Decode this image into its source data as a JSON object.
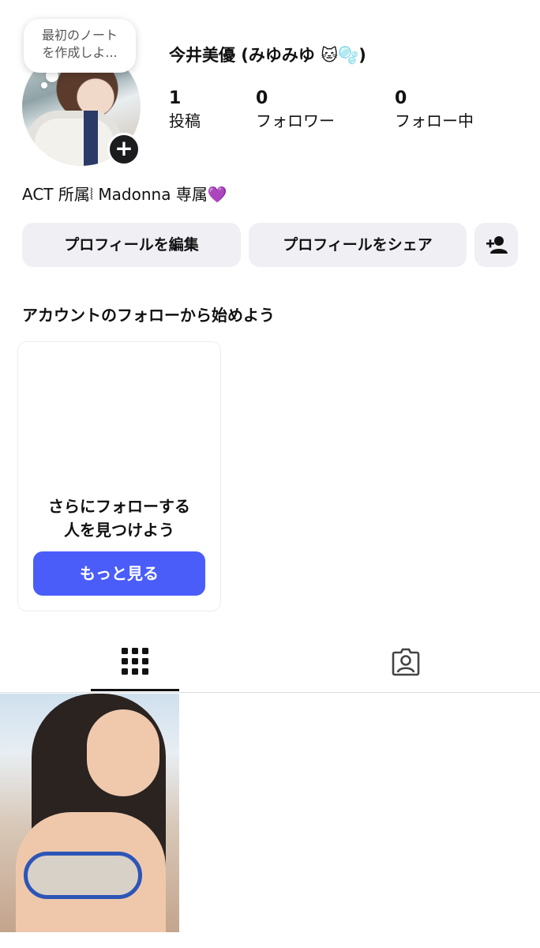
{
  "profile": {
    "note_text_line1": "最初のノート",
    "note_text_line2": "を作成しよ...",
    "username": "今井美優 (みゆみゆ 🐱🫧)",
    "bio": "ACT 所属⦚ Madonna 専属💜",
    "stats": [
      {
        "value": "1",
        "label": "投稿"
      },
      {
        "value": "0",
        "label": "フォロワー"
      },
      {
        "value": "0",
        "label": "フォロー中"
      }
    ]
  },
  "actions": {
    "edit_profile": "プロフィールを編集",
    "share_profile": "プロフィールをシェア"
  },
  "suggestions": {
    "title": "アカウントのフォローから始めよう",
    "card_text_line1": "さらにフォローする",
    "card_text_line2": "人を見つけよう",
    "see_more": "もっと見る"
  },
  "tabs": {
    "active": "grid",
    "items": [
      {
        "icon": "grid-icon"
      },
      {
        "icon": "tagged-person-icon"
      }
    ]
  },
  "colors": {
    "accent": "#4a5df9",
    "button_bg": "#efeff4",
    "text": "#111111"
  }
}
